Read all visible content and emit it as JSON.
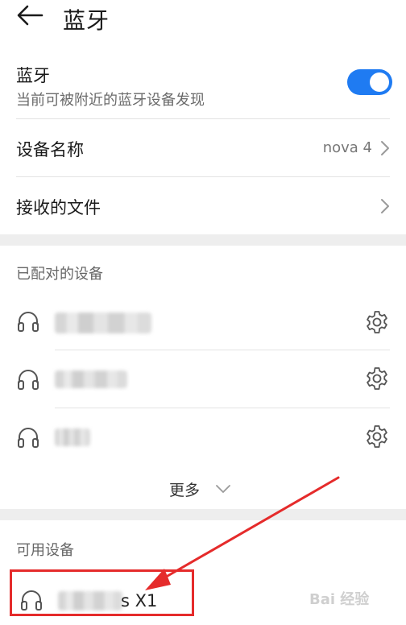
{
  "header": {
    "title": "蓝牙"
  },
  "bluetooth": {
    "label": "蓝牙",
    "subtitle": "当前可被附近的蓝牙设备发现",
    "enabled": true,
    "accent_color": "#1f7bf2"
  },
  "device_name": {
    "label": "设备名称",
    "value": "nova 4"
  },
  "received_files": {
    "label": "接收的文件"
  },
  "paired": {
    "header": "已配对的设备",
    "devices": [
      {
        "icon": "headset-icon",
        "settings_icon": "gear-icon"
      },
      {
        "icon": "headset-icon",
        "settings_icon": "gear-icon"
      },
      {
        "icon": "headset-icon",
        "settings_icon": "gear-icon"
      }
    ],
    "more_label": "更多"
  },
  "available": {
    "header": "可用设备",
    "devices": [
      {
        "icon": "headset-icon",
        "name_visible": "s X1"
      }
    ]
  },
  "annotation": {
    "color": "#e52b2b"
  },
  "watermark": {
    "text": "Bai 经验"
  }
}
